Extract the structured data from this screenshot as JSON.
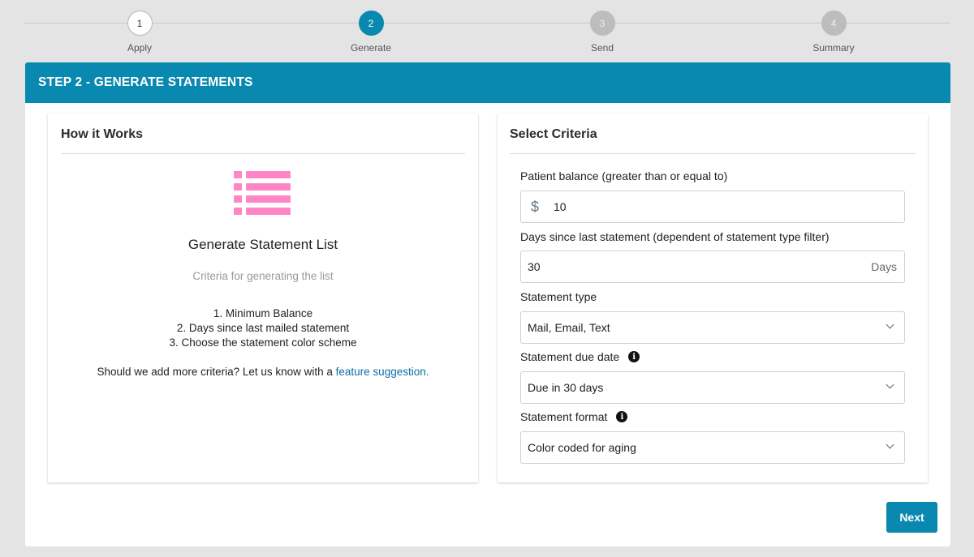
{
  "stepper": {
    "steps": [
      {
        "number": "1",
        "label": "Apply",
        "state": "done"
      },
      {
        "number": "2",
        "label": "Generate",
        "state": "active"
      },
      {
        "number": "3",
        "label": "Send",
        "state": "pending"
      },
      {
        "number": "4",
        "label": "Summary",
        "state": "pending"
      }
    ]
  },
  "header": {
    "title": "STEP 2 - GENERATE STATEMENTS"
  },
  "how_it_works": {
    "title": "How it Works",
    "icon": "list-icon",
    "heading": "Generate Statement List",
    "subtitle": "Criteria for generating the list",
    "steps": [
      "1. Minimum Balance",
      "2. Days since last mailed statement",
      "3. Choose the statement color scheme"
    ],
    "suggestion_text": "Should we add more criteria? Let us know with a ",
    "suggestion_link": "feature suggestion."
  },
  "criteria": {
    "title": "Select Criteria",
    "balance": {
      "label": "Patient balance (greater than or equal to)",
      "prefix": "$",
      "value": "10"
    },
    "days": {
      "label": "Days since last statement (dependent of statement type filter)",
      "value": "30",
      "suffix": "Days"
    },
    "statement_type": {
      "label": "Statement type",
      "value": "Mail, Email, Text"
    },
    "due_date": {
      "label": "Statement due date",
      "value": "Due in 30 days"
    },
    "format": {
      "label": "Statement format",
      "value": "Color coded for aging"
    }
  },
  "actions": {
    "next_label": "Next"
  },
  "colors": {
    "accent": "#0a89b0",
    "icon_pink": "#ff86c6",
    "link": "#0a6fa8"
  }
}
